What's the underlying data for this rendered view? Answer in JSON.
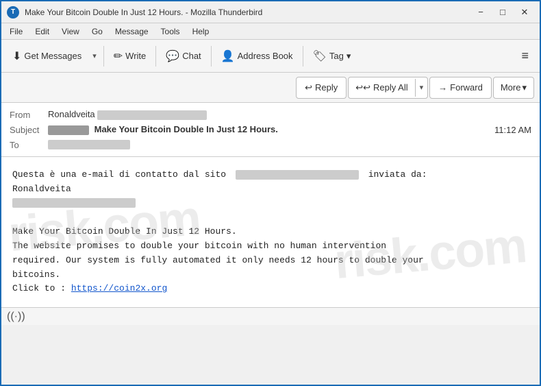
{
  "titleBar": {
    "icon": "T",
    "title": "Make Your Bitcoin Double In Just 12 Hours. - Mozilla Thunderbird",
    "minimizeLabel": "−",
    "maximizeLabel": "□",
    "closeLabel": "✕"
  },
  "menuBar": {
    "items": [
      "File",
      "Edit",
      "View",
      "Go",
      "Message",
      "Tools",
      "Help"
    ]
  },
  "toolbar": {
    "getMessages": "Get Messages",
    "write": "Write",
    "chat": "Chat",
    "addressBook": "Address Book",
    "tag": "Tag",
    "hamburger": "≡"
  },
  "actionBar": {
    "reply": "Reply",
    "replyAll": "Reply All",
    "forward": "Forward",
    "more": "More"
  },
  "email": {
    "fromLabel": "From",
    "fromName": "Ronaldveita",
    "fromEmailBlur": "████████████████████",
    "subjectLabel": "Subject",
    "subjectPrefix": "██████",
    "subjectText": "Make Your Bitcoin Double In Just 12 Hours.",
    "time": "11:12 AM",
    "toLabel": "To",
    "toBlur": "████████████████",
    "body": {
      "line1": "Questa è una e-mail di contatto dal sito",
      "line1b": "██████████████████████████████",
      "line1c": "inviata da:",
      "line2": "Ronaldveita",
      "line3": "████████████████████████",
      "line4": "",
      "line5": "Make Your Bitcoin Double In Just 12 Hours.",
      "line6": "The website promises to double your bitcoin with no human intervention",
      "line7": "required. Our system is fully automated it only needs 12 hours to double your",
      "line8": "bitcoins.",
      "line9": "Click to :",
      "link": "https://coin2x.org"
    }
  },
  "statusBar": {
    "icon": "((·))"
  }
}
